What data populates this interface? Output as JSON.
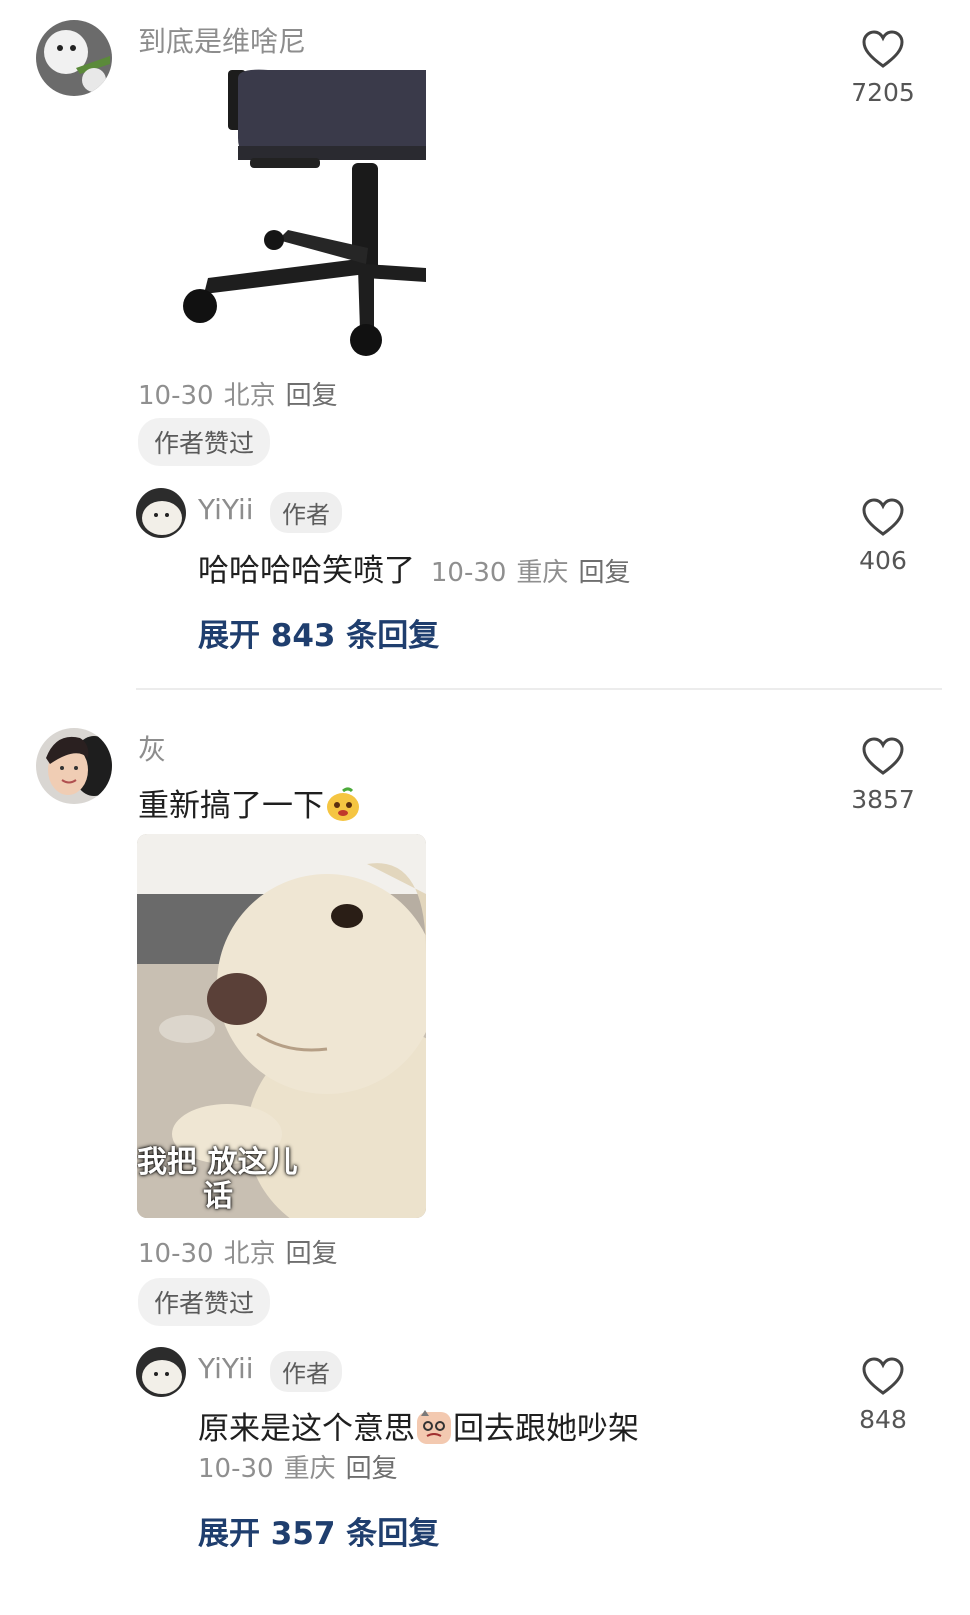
{
  "comments": [
    {
      "user": "到底是维啥尼",
      "meta": {
        "date": "10-30",
        "location": "北京",
        "reply_label": "回复"
      },
      "author_liked": "作者赞过",
      "likes": "7205",
      "image": "office-chair-photo",
      "reply": {
        "user": "YiYii",
        "tag": "作者",
        "text": "哈哈哈哈笑喷了",
        "meta": {
          "date": "10-30",
          "location": "重庆",
          "reply_label": "回复"
        },
        "likes": "406"
      },
      "expand": "展开 843 条回复"
    },
    {
      "user": "灰",
      "text": "重新搞了一下",
      "meta": {
        "date": "10-30",
        "location": "北京",
        "reply_label": "回复"
      },
      "author_liked": "作者赞过",
      "likes": "3857",
      "image": "dog-meme-photo",
      "image_caption": {
        "line1": "我把   放这儿",
        "line2": "话"
      },
      "reply": {
        "user": "YiYii",
        "tag": "作者",
        "text_before": "原来是这个意思",
        "text_after": "回去跟她吵架",
        "meta": {
          "date": "10-30",
          "location": "重庆",
          "reply_label": "回复"
        },
        "likes": "848"
      },
      "expand": "展开 357 条回复"
    }
  ],
  "icons": {
    "like": "heart-outline-icon",
    "emoji1": "mango-face-emoji",
    "emoji2": "smirk-face-emoji"
  },
  "colors": {
    "link": "#1f3e6e",
    "muted": "#8f8f8f",
    "text": "#1f1f1f",
    "pill_bg": "#f1f1f1"
  }
}
